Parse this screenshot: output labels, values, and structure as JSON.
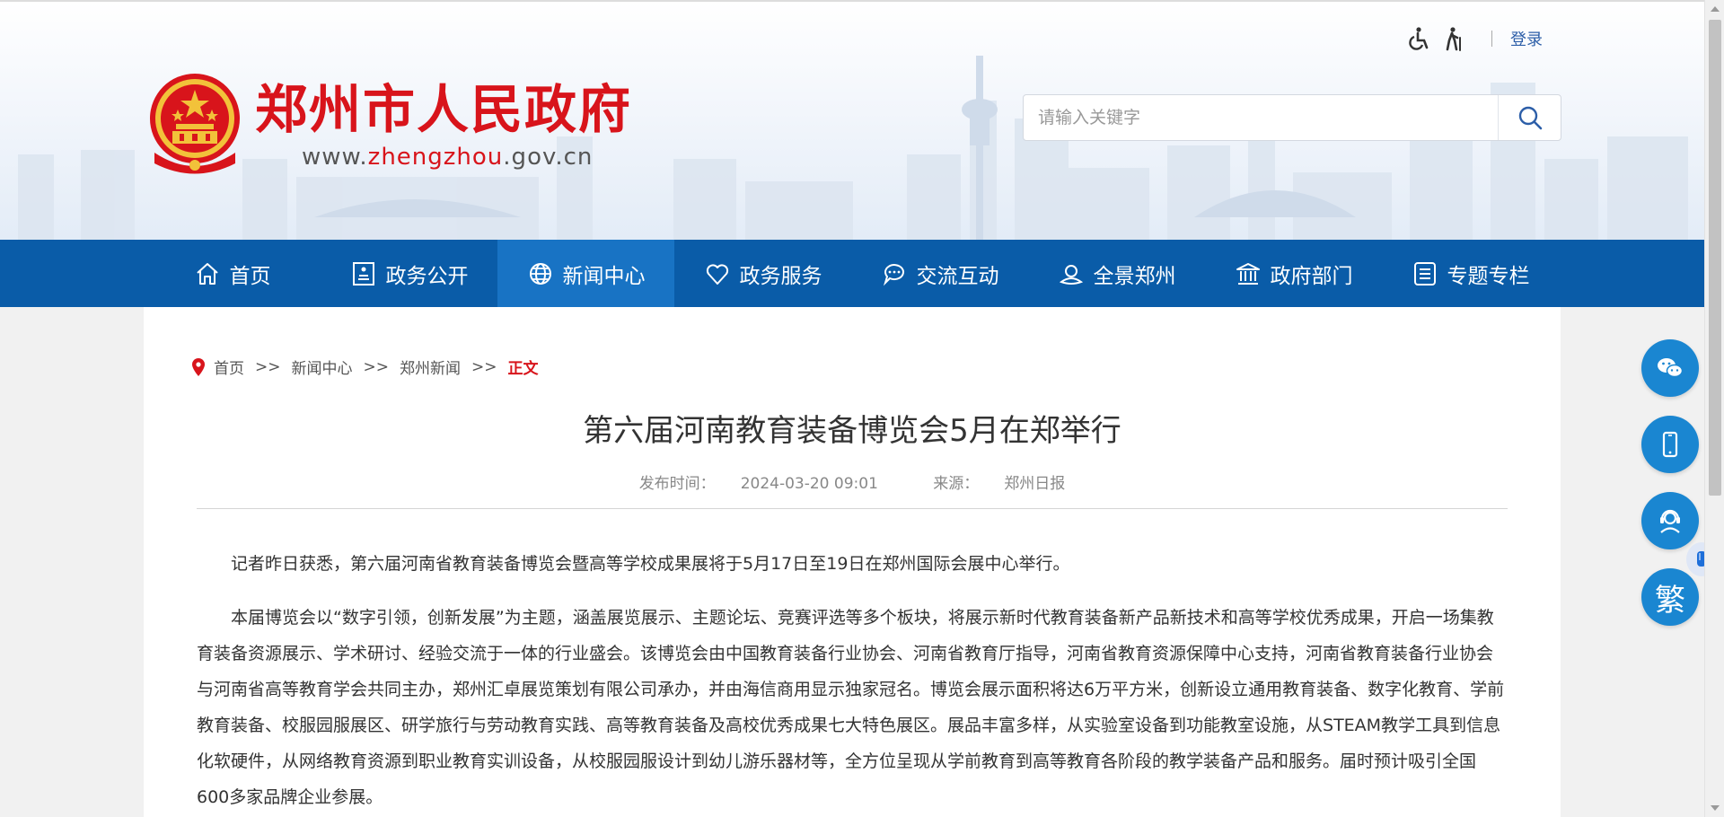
{
  "header": {
    "logo_title": "郑州市人民政府",
    "logo_url_prefix": "www.",
    "logo_url_highlight": "zhengzhou",
    "logo_url_suffix": ".gov.cn",
    "login_label": "登录",
    "search_placeholder": "请输入关键字"
  },
  "nav": {
    "items": [
      {
        "label": "首页",
        "icon": "home-icon"
      },
      {
        "label": "政务公开",
        "icon": "document-icon"
      },
      {
        "label": "新闻中心",
        "icon": "globe-icon"
      },
      {
        "label": "政务服务",
        "icon": "heart-icon"
      },
      {
        "label": "交流互动",
        "icon": "chat-icon"
      },
      {
        "label": "全景郑州",
        "icon": "panorama-icon"
      },
      {
        "label": "政府部门",
        "icon": "building-icon"
      },
      {
        "label": "专题专栏",
        "icon": "list-icon"
      }
    ],
    "active_index": 2
  },
  "breadcrumb": {
    "items": [
      "首页",
      "新闻中心",
      "郑州新闻"
    ],
    "separator": ">>",
    "current": "正文"
  },
  "article": {
    "title": "第六届河南教育装备博览会5月在郑举行",
    "publish_label": "发布时间：",
    "publish_time": "2024-03-20 09:01",
    "source_label": "来源：",
    "source": "郑州日报",
    "paragraphs": [
      "记者昨日获悉，第六届河南省教育装备博览会暨高等学校成果展将于5月17日至19日在郑州国际会展中心举行。",
      "本届博览会以“数字引领，创新发展”为主题，涵盖展览展示、主题论坛、竞赛评选等多个板块，将展示新时代教育装备新产品新技术和高等学校优秀成果，开启一场集教育装备资源展示、学术研讨、经验交流于一体的行业盛会。该博览会由中国教育装备行业协会、河南省教育厅指导，河南省教育资源保障中心支持，河南省教育装备行业协会与河南省高等教育学会共同主办，郑州汇卓展览策划有限公司承办，并由海信商用显示独家冠名。博览会展示面积将达6万平方米，创新设立通用教育装备、数字化教育、学前教育装备、校服园服展区、研学旅行与劳动教育实践、高等教育装备及高校优秀成果七大特色展区。展品丰富多样，从实验室设备到功能教室设施，从STEAM教学工具到信息化软硬件，从网络教育资源到职业教育实训设备，从校服园服设计到幼儿游乐器材等，全方位呈现从学前教育到高等教育各阶段的教学装备产品和服务。届时预计吸引全国600多家品牌企业参展。"
    ]
  },
  "side_buttons": {
    "traditional_label": "繁"
  },
  "colors": {
    "brand_red": "#d8141b",
    "nav_blue": "#0a5ca8",
    "nav_active": "#1873c4",
    "side_button_blue": "#1a86d1"
  }
}
